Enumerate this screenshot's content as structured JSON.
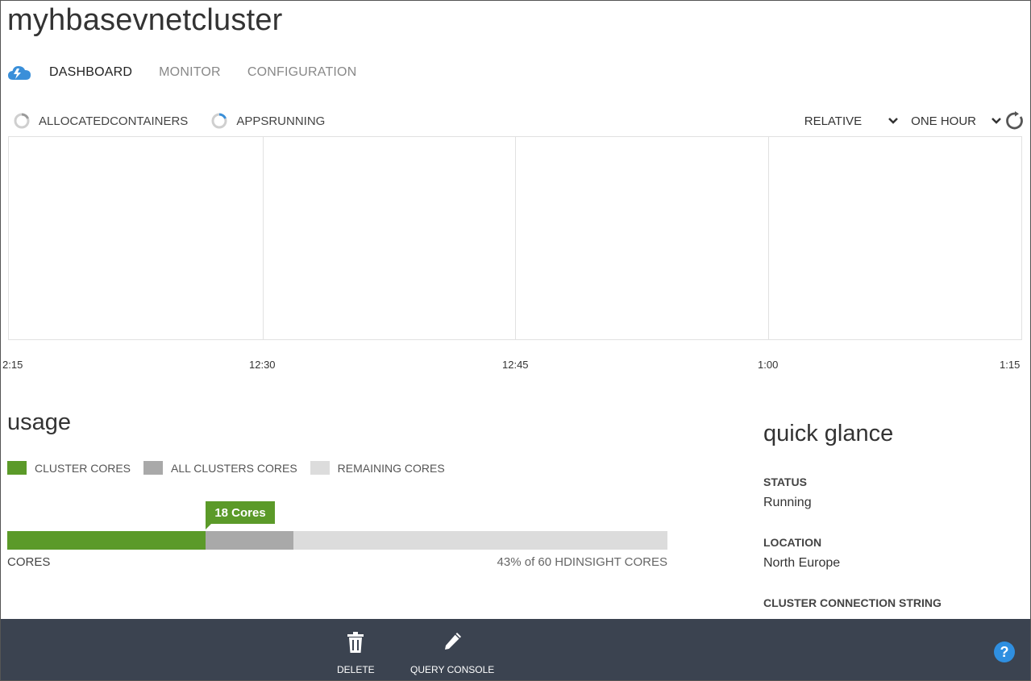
{
  "page": {
    "title": "myhbasevnetcluster"
  },
  "tabs": [
    {
      "label": "DASHBOARD",
      "active": true
    },
    {
      "label": "MONITOR",
      "active": false
    },
    {
      "label": "CONFIGURATION",
      "active": false
    }
  ],
  "metrics": [
    {
      "label": "ALLOCATEDCONTAINERS"
    },
    {
      "label": "APPSRUNNING"
    }
  ],
  "controls": {
    "scale": "RELATIVE",
    "range": "ONE HOUR"
  },
  "chart_data": {
    "type": "line",
    "x_ticks": [
      "2:15",
      "12:30",
      "12:45",
      "1:00",
      "1:15"
    ],
    "series": []
  },
  "usage": {
    "title": "usage",
    "legend": [
      {
        "label": "CLUSTER CORES",
        "color": "#5b9a29"
      },
      {
        "label": "ALL CLUSTERS CORES",
        "color": "#a9a9a9"
      },
      {
        "label": "REMAINING CORES",
        "color": "#dcdcdc"
      }
    ],
    "callout": "18 Cores",
    "bar_label": "CORES",
    "summary": "43% of 60 HDINSIGHT CORES",
    "cluster_cores": 18,
    "all_clusters_cores": 26,
    "total_cores": 60
  },
  "quick_glance": {
    "title": "quick glance",
    "status_label": "STATUS",
    "status_value": "Running",
    "location_label": "LOCATION",
    "location_value": "North Europe",
    "connection_label": "CLUSTER CONNECTION STRING"
  },
  "footer": {
    "delete_label": "DELETE",
    "query_console_label": "QUERY CONSOLE",
    "help_label": "?"
  }
}
